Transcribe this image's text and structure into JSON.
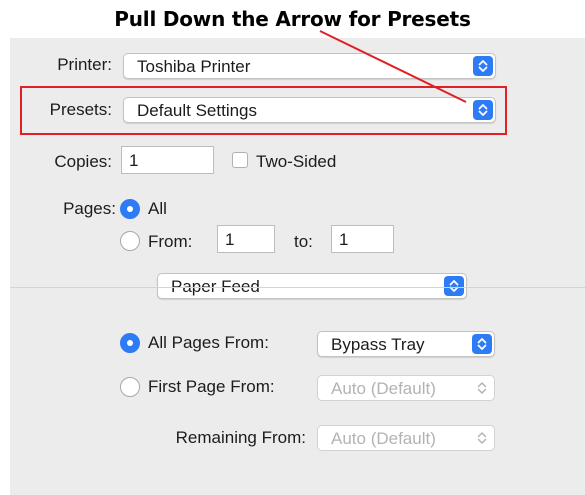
{
  "annotation": {
    "title": "Pull Down the Arrow for Presets",
    "color": "#e11f26"
  },
  "printer": {
    "label": "Printer:",
    "value": "Toshiba Printer"
  },
  "presets": {
    "label": "Presets:",
    "value": "Default Settings"
  },
  "copies": {
    "label": "Copies:",
    "value": "1",
    "two_sided_label": "Two-Sided",
    "two_sided_checked": false
  },
  "pages": {
    "label": "Pages:",
    "all_label": "All",
    "all_selected": true,
    "from_label": "From:",
    "from_value": "1",
    "to_label": "to:",
    "to_value": "1"
  },
  "section_popup": {
    "value": "Paper Feed"
  },
  "paper_feed": {
    "all_pages_from_label": "All Pages From:",
    "all_pages_from_value": "Bypass Tray",
    "all_pages_selected": true,
    "first_page_from_label": "First Page From:",
    "first_page_from_value": "Auto (Default)",
    "remaining_from_label": "Remaining From:",
    "remaining_from_value": "Auto (Default)"
  },
  "accent_color": "#2e7bf6",
  "icons": {
    "popup": "up-down-chevron-icon"
  }
}
